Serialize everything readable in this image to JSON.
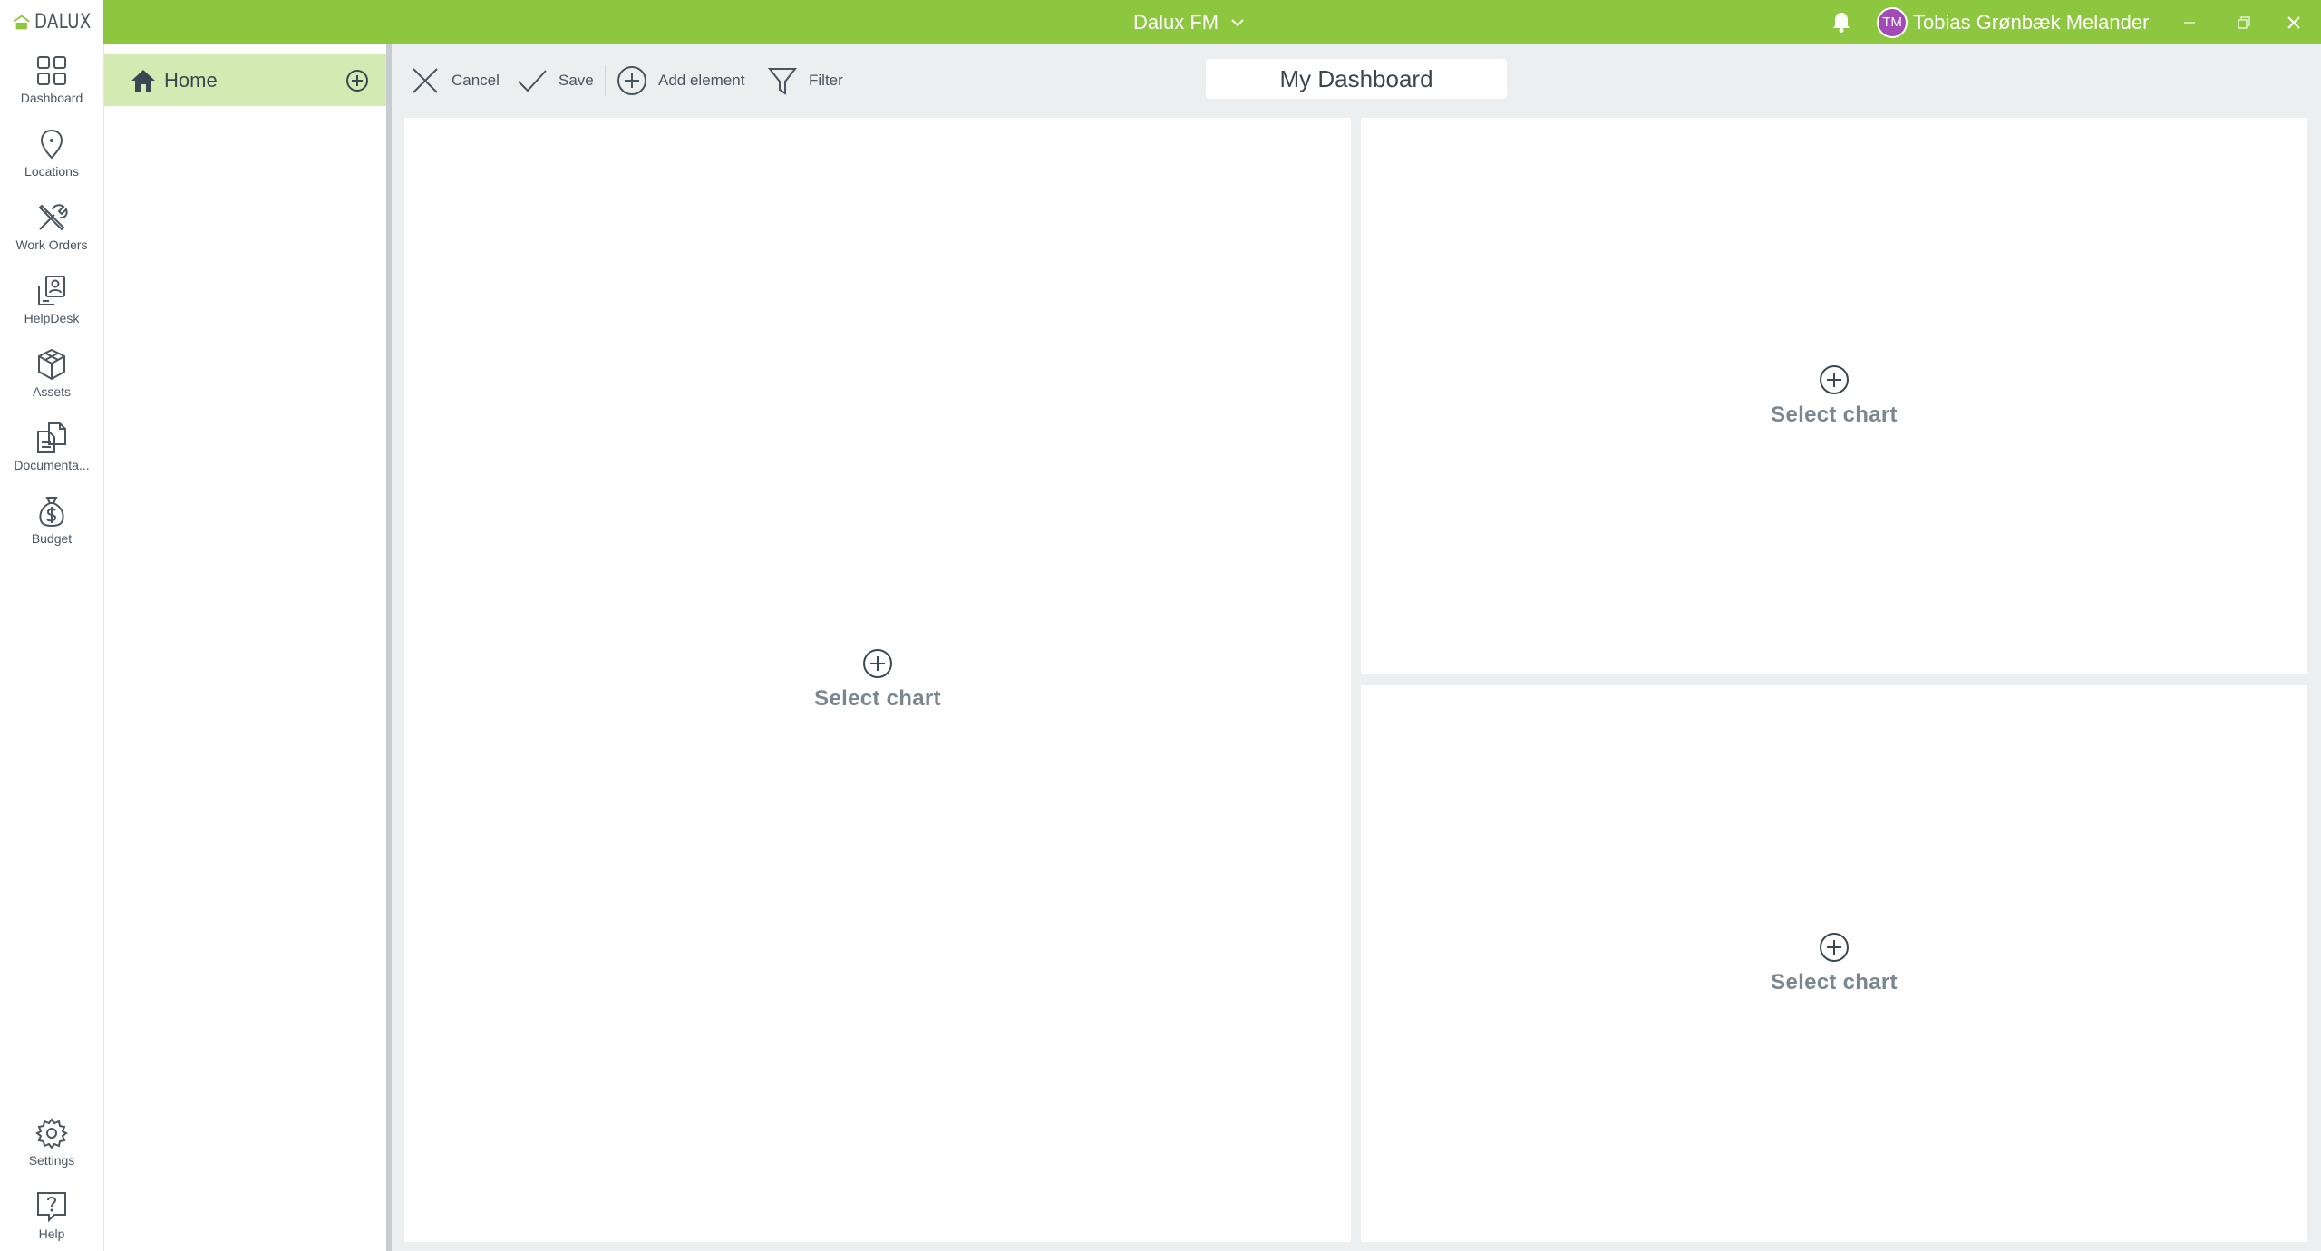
{
  "app": {
    "logo_text": "DALUX",
    "title": "Dalux FM",
    "user_name": "Tobias Grønbæk Melander",
    "user_initials": "TM",
    "colors": {
      "brand": "#8dc63f",
      "active_item": "#d4eab3",
      "avatar": "#a24bb8"
    }
  },
  "nav": {
    "items": [
      {
        "label": "Dashboard",
        "icon": "dashboard-icon"
      },
      {
        "label": "Locations",
        "icon": "location-pin-icon"
      },
      {
        "label": "Work Orders",
        "icon": "tools-icon"
      },
      {
        "label": "HelpDesk",
        "icon": "helpdesk-icon"
      },
      {
        "label": "Assets",
        "icon": "assets-cube-icon"
      },
      {
        "label": "Documenta...",
        "icon": "documents-icon"
      },
      {
        "label": "Budget",
        "icon": "money-bag-icon"
      }
    ],
    "bottom_items": [
      {
        "label": "Settings",
        "icon": "gear-icon"
      },
      {
        "label": "Help",
        "icon": "help-icon"
      }
    ]
  },
  "side": {
    "home_label": "Home"
  },
  "toolbar": {
    "cancel_label": "Cancel",
    "save_label": "Save",
    "add_element_label": "Add element",
    "filter_label": "Filter",
    "dashboard_title": "My Dashboard"
  },
  "panels": [
    {
      "label": "Select chart"
    },
    {
      "label": "Select chart"
    },
    {
      "label": "Select chart"
    }
  ]
}
